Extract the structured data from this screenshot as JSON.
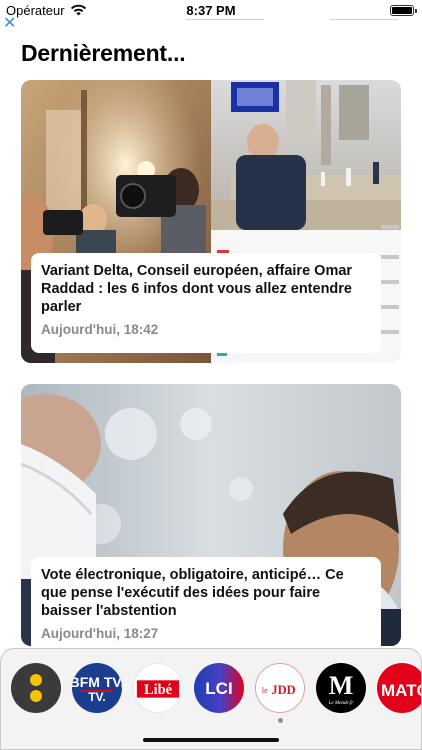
{
  "status_bar": {
    "carrier": "Opérateur",
    "time": "8:37 PM"
  },
  "ad": {
    "close_glyph": "✕"
  },
  "section_title": "Dernièrement...",
  "articles": [
    {
      "title": "Variant Delta, Conseil européen, affaire Omar Raddad : les 6 infos dont vous allez entendre parler",
      "time": "Aujourd'hui, 18:42"
    },
    {
      "title": "Vote électronique, obligatoire, anticipé… Ce que pense l'exécutif des idées pour faire baisser l'abstention",
      "time": "Aujourd'hui, 18:27"
    }
  ],
  "sources": [
    {
      "name": "app-home",
      "icon": "double-dot-icon",
      "color": "#3a3a3a",
      "text": ""
    },
    {
      "name": "bfm-tv",
      "text": "BFM TV.",
      "color": "#1a3d8f"
    },
    {
      "name": "liberation",
      "text": "Libé",
      "color": "#e2001a"
    },
    {
      "name": "lci",
      "text": "LCI",
      "color": "#1e3fb4"
    },
    {
      "name": "le-jdd",
      "text": "JDD",
      "color": "#d91a20"
    },
    {
      "name": "le-monde",
      "text": "M",
      "caption": "Le Monde.fr",
      "color": "#000000"
    },
    {
      "name": "paris-match",
      "text": "MATC",
      "color": "#e2001a"
    }
  ]
}
